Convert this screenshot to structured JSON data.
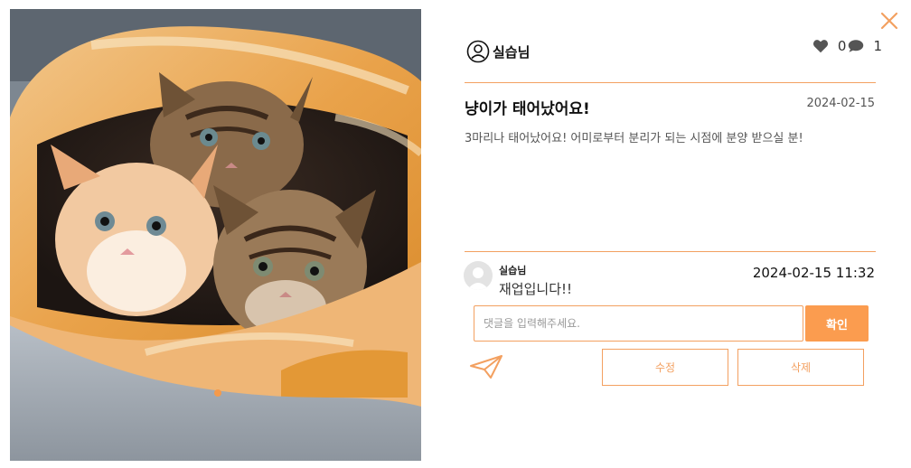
{
  "post": {
    "author": "실습님",
    "likes": "0",
    "comments": "1",
    "title": "냥이가 태어났어요!",
    "date": "2024-02-15",
    "body": "3마리나 태어났어요! 어미로부터 분리가 되는 시점에 분양 받으실 분!"
  },
  "comment": {
    "author": "실습님",
    "text": "재업입니다!!",
    "date": "2024-02-15 11:32"
  },
  "form": {
    "placeholder": "댓글을 입력해주세요.",
    "confirm_label": "확인",
    "edit_label": "수정",
    "delete_label": "삭제"
  },
  "icons": {
    "close": "close-icon",
    "user": "user-icon",
    "heart": "heart-icon",
    "comment": "comment-icon",
    "send": "send-icon"
  },
  "colors": {
    "accent": "#fb9c4f",
    "border": "#f3a060"
  }
}
